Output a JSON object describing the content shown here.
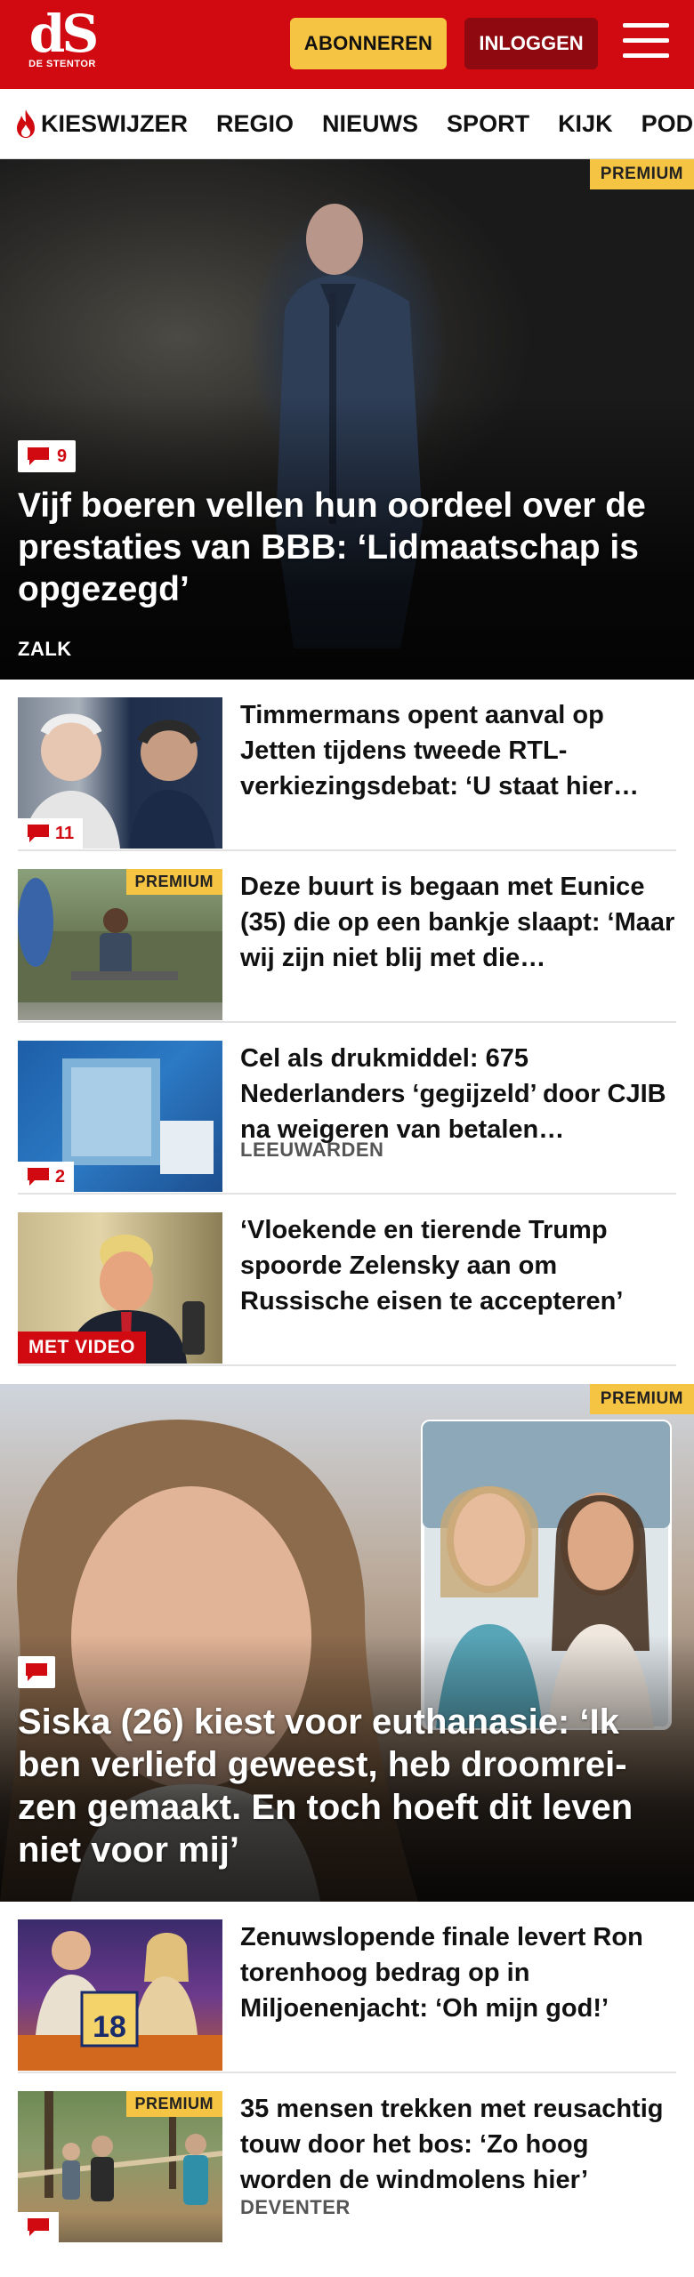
{
  "header": {
    "logo_mark": "dS",
    "logo_sub": "DE STENTOR",
    "subscribe_label": "ABONNEREN",
    "login_label": "INLOGGEN",
    "menu_icon": "hamburger-icon",
    "brand_color": "#d10a11",
    "accent_color": "#f6c443"
  },
  "nav": {
    "items": [
      {
        "label": "KIESWIJZER",
        "icon": "flame-icon"
      },
      {
        "label": "REGIO"
      },
      {
        "label": "NIEUWS"
      },
      {
        "label": "SPORT"
      },
      {
        "label": "KIJK"
      },
      {
        "label": "PODCAST"
      }
    ]
  },
  "hero1": {
    "badge": "PREMIUM",
    "comments": "9",
    "title": "Vijf boeren vellen hun oordeel over de prestaties van BBB: ‘Lidmaatschap is opgezegd’",
    "location": "ZALK"
  },
  "list1": [
    {
      "title": "Timmermans opent aanval op Jetten tijdens tweede RTL-verkiezingsdebat: ‘U staat hier…",
      "comments": "11"
    },
    {
      "title": "Deze buurt is begaan met Eunice (35) die op een bankje slaapt: ‘Maar wij zijn niet blij met die…",
      "badge": "PREMIUM"
    },
    {
      "title": "Cel als drukmiddel: 675 Nederlanders ‘gegijzeld’ door CJIB na weigeren van betalen…",
      "comments": "2",
      "location": "LEEUWARDEN"
    },
    {
      "title": "‘Vloekende en tierende Trump spoorde Zelensky aan om Russische eisen te accepteren’",
      "video": "MET VIDEO"
    }
  ],
  "hero2": {
    "badge": "PREMIUM",
    "title": "Siska (26) kiest voor euthanasie: ‘Ik ben verliefd geweest, heb droomrei­zen gemaakt. En toch hoeft dit leven niet voor mij’"
  },
  "list2": [
    {
      "title": "Zenuwslopende finale levert Ron torenhoog bedrag op in Miljoenenjacht: ‘Oh mijn god!’",
      "podium_number": "18"
    },
    {
      "title": "35 mensen trekken met reusachtig touw door het bos: ‘Zo hoog worden de windmolens hier’",
      "badge": "PREMIUM",
      "location": "DEVENTER"
    }
  ]
}
